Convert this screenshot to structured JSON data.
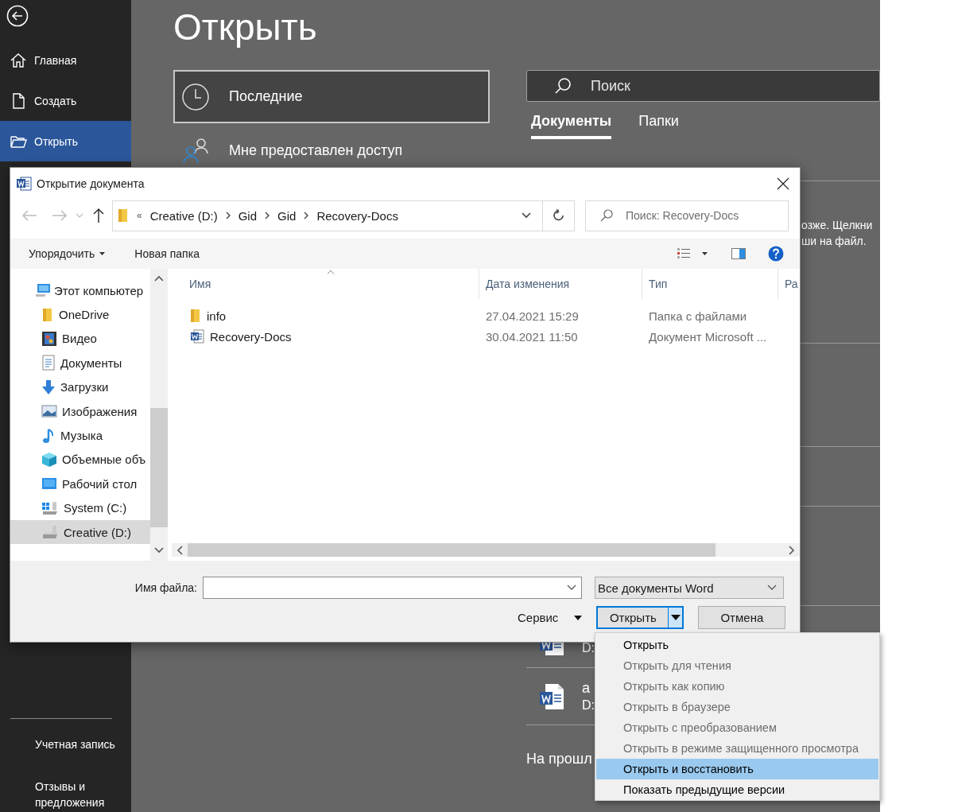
{
  "backstage": {
    "nav_items": [
      {
        "label": "Главная",
        "selected": false
      },
      {
        "label": "Создать",
        "selected": false
      },
      {
        "label": "Открыть",
        "selected": true
      }
    ],
    "bottom_items": [
      "Учетная запись",
      "Отзывы и предложения"
    ],
    "page_title": "Открыть",
    "locations": [
      {
        "label": "Последние",
        "selected": true
      },
      {
        "label": "Мне предоставлен доступ",
        "selected": false
      }
    ],
    "search": {
      "placeholder": "Поиск"
    },
    "tabs": [
      {
        "label": "Документы",
        "selected": true
      },
      {
        "label": "Папки",
        "selected": false
      }
    ],
    "hint_lines": [
      "озже. Щелкни",
      "ши на файл."
    ],
    "recent_files": [
      {
        "path": "D:"
      },
      {
        "name": "a",
        "path": "D:"
      }
    ],
    "section_heading": "На прошл"
  },
  "dialog": {
    "title": "Открытие документа",
    "breadcrumb_overflow": "«",
    "breadcrumb": [
      "Creative (D:)",
      "Gid",
      "Gid",
      "Recovery-Docs"
    ],
    "search": {
      "placeholder": "Поиск: Recovery-Docs"
    },
    "toolbar": {
      "organize": "Упорядочить",
      "new_folder": "Новая папка"
    },
    "tree": [
      {
        "label": "Этот компьютер",
        "selected": false,
        "children": [
          {
            "label": "OneDrive",
            "selected": false
          },
          {
            "label": "Видео",
            "selected": false
          },
          {
            "label": "Документы",
            "selected": false
          },
          {
            "label": "Загрузки",
            "selected": false
          },
          {
            "label": "Изображения",
            "selected": false
          },
          {
            "label": "Музыка",
            "selected": false
          },
          {
            "label": "Объемные объ",
            "selected": false
          },
          {
            "label": "Рабочий стол",
            "selected": false
          },
          {
            "label": "System (C:)",
            "selected": false
          },
          {
            "label": "Creative (D:)",
            "selected": true
          }
        ]
      }
    ],
    "columns": [
      "Имя",
      "Дата изменения",
      "Тип",
      "Ра"
    ],
    "rows": [
      {
        "kind": "folder",
        "name": "info",
        "modified": "27.04.2021 15:29",
        "type": "Папка с файлами"
      },
      {
        "kind": "word",
        "name": "Recovery-Docs",
        "modified": "30.04.2021 11:50",
        "type": "Документ Microsoft ..."
      }
    ],
    "file_name_label": "Имя файла:",
    "filter": "Все документы Word",
    "tools": "Сервис",
    "open_button": "Открыть",
    "cancel_button": "Отмена",
    "open_menu": [
      {
        "label": "Открыть",
        "disabled": false,
        "selected": false
      },
      {
        "label": "Открыть для чтения",
        "disabled": true,
        "selected": false
      },
      {
        "label": "Открыть как копию",
        "disabled": true,
        "selected": false
      },
      {
        "label": "Открыть в браузере",
        "disabled": true,
        "selected": false
      },
      {
        "label": "Открыть с преобразованием",
        "disabled": true,
        "selected": false
      },
      {
        "label": "Открыть в режиме защищенного просмотра",
        "disabled": true,
        "selected": false
      },
      {
        "label": "Открыть и восстановить",
        "disabled": false,
        "selected": true
      },
      {
        "label": "Показать предыдущие версии",
        "disabled": false,
        "selected": false
      }
    ]
  }
}
